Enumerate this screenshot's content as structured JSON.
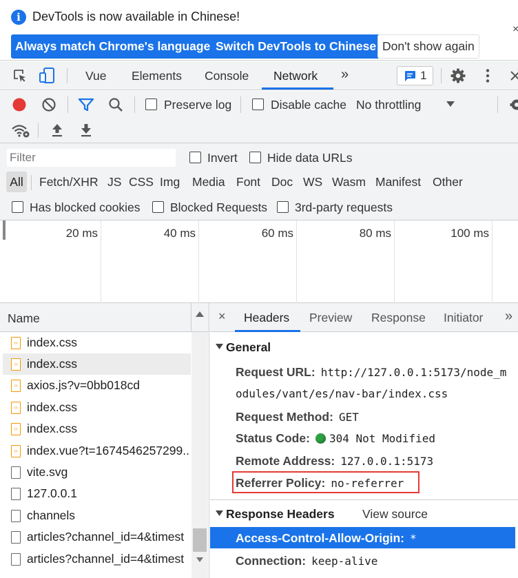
{
  "infobar": {
    "message": "DevTools is now available in Chinese!",
    "btn_match": "Always match Chrome's language",
    "btn_switch": "Switch DevTools to Chinese",
    "btn_dismiss": "Don't show again",
    "close": "×"
  },
  "tabs": {
    "items": [
      "Vue",
      "Elements",
      "Console",
      "Network"
    ],
    "more": "»",
    "issues_count": "1",
    "active": "Network"
  },
  "toolbar": {
    "preserve_log": "Preserve log",
    "disable_cache": "Disable cache",
    "throttling": "No throttling"
  },
  "filter": {
    "placeholder": "Filter",
    "invert": "Invert",
    "hide_data_urls": "Hide data URLs",
    "types": [
      "All",
      "Fetch/XHR",
      "JS",
      "CSS",
      "Img",
      "Media",
      "Font",
      "Doc",
      "WS",
      "Wasm",
      "Manifest",
      "Other"
    ],
    "has_blocked_cookies": "Has blocked cookies",
    "blocked_requests": "Blocked Requests",
    "third_party": "3rd-party requests"
  },
  "timeline": {
    "ticks": [
      "20 ms",
      "40 ms",
      "60 ms",
      "80 ms",
      "100 ms"
    ]
  },
  "request_list": {
    "header": "Name",
    "rows": [
      {
        "name": "index.css",
        "icon": "css-file-icon"
      },
      {
        "name": "index.css",
        "icon": "css-file-icon"
      },
      {
        "name": "axios.js?v=0bb018cd",
        "icon": "css-file-icon"
      },
      {
        "name": "index.css",
        "icon": "css-file-icon"
      },
      {
        "name": "index.css",
        "icon": "css-file-icon"
      },
      {
        "name": "index.vue?t=1674546257299..",
        "icon": "css-file-icon"
      },
      {
        "name": "vite.svg",
        "icon": "document-icon"
      },
      {
        "name": "127.0.0.1",
        "icon": "document-icon"
      },
      {
        "name": "channels",
        "icon": "document-icon"
      },
      {
        "name": "articles?channel_id=4&timest",
        "icon": "document-icon"
      },
      {
        "name": "articles?channel_id=4&timest",
        "icon": "document-icon"
      }
    ]
  },
  "details": {
    "close": "×",
    "tabs": [
      "Headers",
      "Preview",
      "Response",
      "Initiator"
    ],
    "more": "»",
    "general_title": "General",
    "request_url_key": "Request URL:",
    "request_url_line1": "http://127.0.0.1:5173/node_m",
    "request_url_line2": "odules/vant/es/nav-bar/index.css",
    "method_key": "Request Method:",
    "method_val": "GET",
    "status_key": "Status Code:",
    "status_val": "304 Not Modified",
    "remote_key": "Remote Address:",
    "remote_val": "127.0.0.1:5173",
    "referrer_key": "Referrer Policy:",
    "referrer_val": "no-referrer",
    "response_title": "Response Headers",
    "view_source": "View source",
    "acao_key": "Access-Control-Allow-Origin:",
    "acao_val": "*",
    "connection_key": "Connection:",
    "connection_val": "keep-alive"
  },
  "colors": {
    "accent": "#1a73e8",
    "record": "#e53935",
    "status_ok": "#2ea043",
    "css_icon": "#f29900"
  }
}
